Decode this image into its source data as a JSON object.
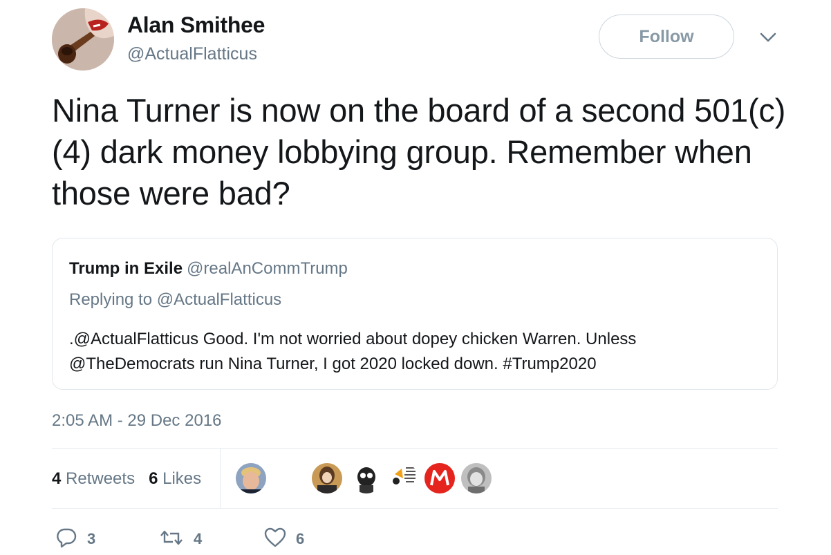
{
  "author": {
    "display_name": "Alan Smithee",
    "handle": "@ActualFlatticus",
    "follow_label": "Follow"
  },
  "tweet": {
    "text": "Nina Turner is now on the board of a second 501(c)(4) dark money lobbying group. Remember when those were bad?"
  },
  "quoted_tweet": {
    "display_name": "Trump in Exile",
    "handle": "@realAnCommTrump",
    "replying_to": "Replying to @ActualFlatticus",
    "text": ".@ActualFlatticus Good. I'm not worried about dopey chicken Warren. Unless @TheDemocrats run Nina Turner, I got 2020 locked down. #Trump2020"
  },
  "timestamp": "2:05 AM - 29 Dec 2016",
  "stats": {
    "retweets_count": "4",
    "retweets_label": "Retweets",
    "likes_count": "6",
    "likes_label": "Likes"
  },
  "actions": {
    "reply_count": "3",
    "retweet_count": "4",
    "like_count": "6"
  },
  "icons": {
    "caret": "chevron-down-icon",
    "reply": "reply-icon",
    "retweet": "retweet-icon",
    "like": "heart-icon"
  },
  "colors": {
    "secondary_text": "#657786",
    "border": "#e1e8ed",
    "primary_text": "#14171a"
  }
}
